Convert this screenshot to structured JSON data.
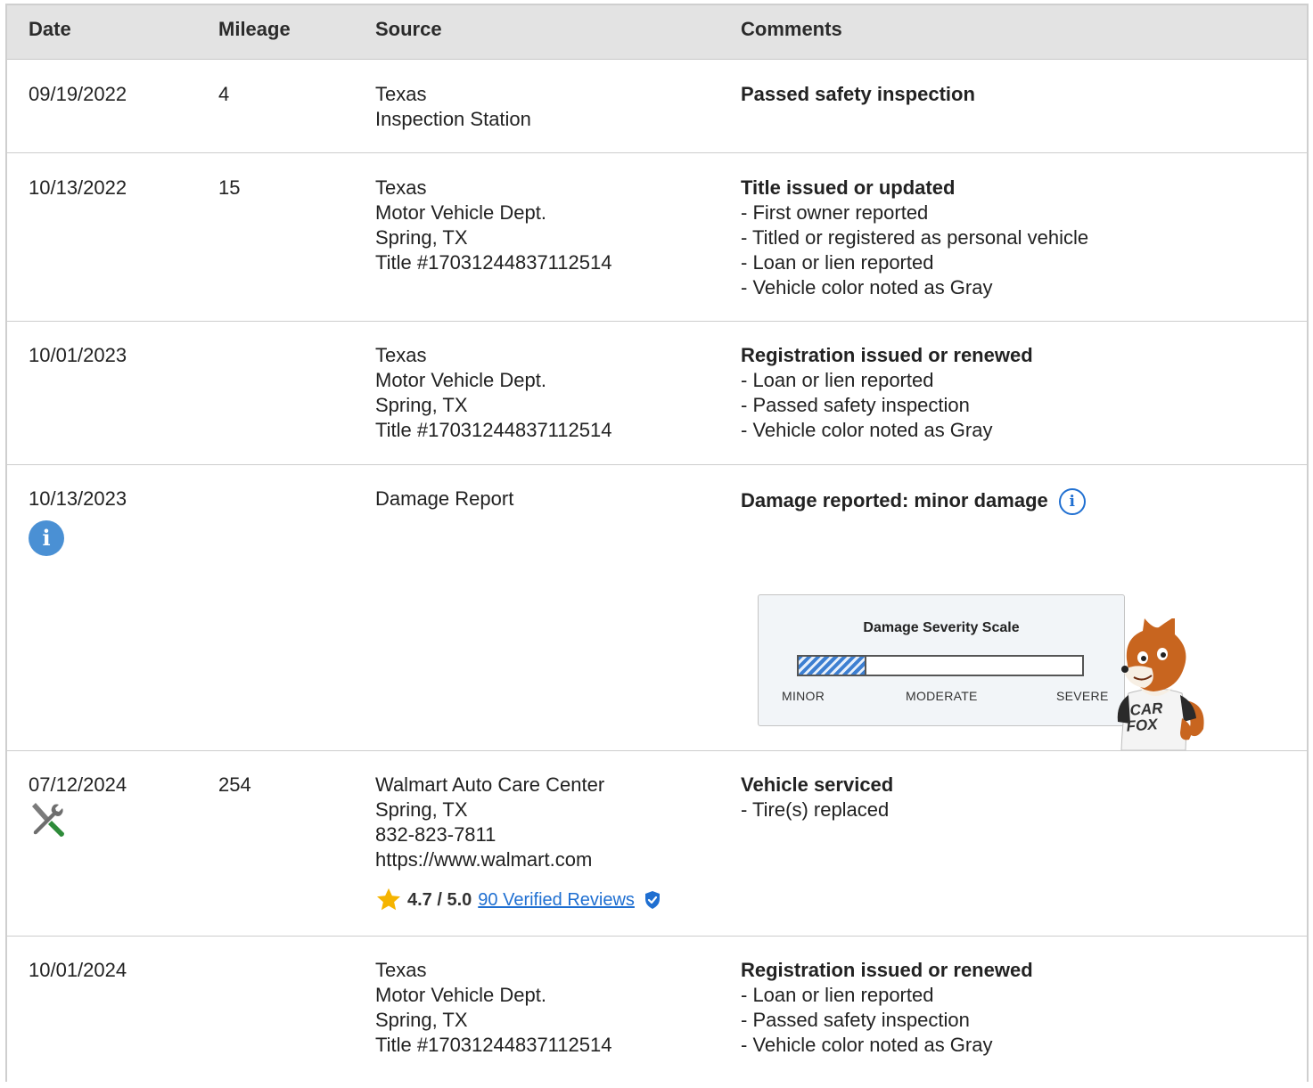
{
  "headers": {
    "date": "Date",
    "mileage": "Mileage",
    "source": "Source",
    "comments": "Comments"
  },
  "rows": [
    {
      "date": "09/19/2022",
      "mileage": "4",
      "source": [
        "Texas",
        "Inspection Station"
      ],
      "comment_title": "Passed safety inspection",
      "comment_items": []
    },
    {
      "date": "10/13/2022",
      "mileage": "15",
      "source": [
        "Texas",
        "Motor Vehicle Dept.",
        "Spring, TX",
        "Title #17031244837112514"
      ],
      "comment_title": "Title issued or updated",
      "comment_items": [
        "- First owner reported",
        "- Titled or registered as personal vehicle",
        "- Loan or lien reported",
        "- Vehicle color noted as Gray"
      ]
    },
    {
      "date": "10/01/2023",
      "mileage": "",
      "source": [
        "Texas",
        "Motor Vehicle Dept.",
        "Spring, TX",
        "Title #17031244837112514"
      ],
      "comment_title": "Registration issued or renewed",
      "comment_items": [
        "- Loan or lien reported",
        "- Passed safety inspection",
        "- Vehicle color noted as Gray"
      ]
    },
    {
      "date": "10/13/2023",
      "mileage": "",
      "date_icon": "info-icon",
      "source": [
        "Damage Report"
      ],
      "comment_title": "Damage reported: minor damage",
      "comment_icon": "info-outline-icon",
      "comment_items": [],
      "severity_scale": {
        "title": "Damage Severity Scale",
        "level": 0.24,
        "labels": [
          "MINOR",
          "MODERATE",
          "SEVERE"
        ],
        "fill_color": "#3d7fd1",
        "mascot_icon": "carfox-mascot-icon",
        "mascot_text": [
          "CAR",
          "FOX"
        ]
      }
    },
    {
      "date": "07/12/2024",
      "mileage": "254",
      "date_icon": "service-tools-icon",
      "source": [
        "Walmart Auto Care Center",
        "Spring, TX",
        "832-823-7811",
        "https://www.walmart.com"
      ],
      "comment_title": "Vehicle serviced",
      "comment_items": [
        "- Tire(s) replaced"
      ],
      "rating": {
        "star_icon": "star-icon",
        "score": "4.7 / 5.0",
        "reviews_link": "90 Verified Reviews",
        "verified_icon": "verified-shield-icon"
      }
    },
    {
      "date": "10/01/2024",
      "mileage": "",
      "source": [
        "Texas",
        "Motor Vehicle Dept.",
        "Spring, TX",
        "Title #17031244837112514"
      ],
      "comment_title": "Registration issued or renewed",
      "comment_items": [
        "- Loan or lien reported",
        "- Passed safety inspection",
        "- Vehicle color noted as Gray"
      ]
    }
  ],
  "colors": {
    "header_bg": "#e3e3e3",
    "link": "#1f6fd1",
    "info_icon": "#4a90d4",
    "star": "#f5b400",
    "wrench_green": "#2e8b3a"
  }
}
